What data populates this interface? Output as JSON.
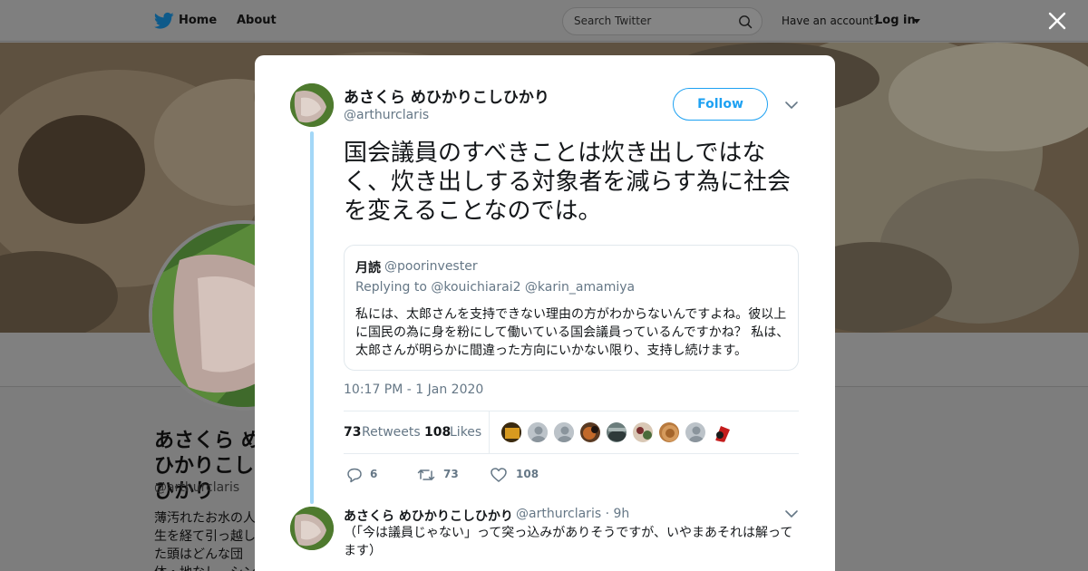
{
  "nav": {
    "home_label": "Home",
    "about_label": "About",
    "search_placeholder": "Search Twitter",
    "have_account": "Have an account?",
    "login_label": "Log in"
  },
  "profile": {
    "name": "あさくら めひかりこしひかり",
    "handle": "@arthurclaris",
    "bio": "薄汚れたお水の人生を経て引っ越した頭はどんな団体・地なし。シン死を主"
  },
  "tweet": {
    "author_name": "あさくら めひかりこしひかり",
    "author_handle": "@arthurclaris",
    "follow_label": "Follow",
    "text": "国会議員のすべきことは炊き出しではなく、炊き出しする対象者を減らす為に社会を変えることなのでは。",
    "quote": {
      "author_name": "月読",
      "author_handle": "@poorinvester",
      "replying_to": "Replying to @kouichiarai2 @karin_amamiya",
      "text": "私には、太郎さんを支持できない理由の方がわからないんですよね。彼以上に国民の為に身を粉にして働いている国会議員っているんですかね？ 私は、太郎さんが明らかに間違った方向にいかない限り、支持し続けます。"
    },
    "timestamp": "10:17 PM - 1 Jan 2020",
    "retweets_count": "73",
    "retweets_label": "Retweets",
    "likes_count": "108",
    "likes_label": "Likes",
    "actions": {
      "reply_count": "6",
      "retweet_count": "73",
      "like_count": "108"
    }
  },
  "reply": {
    "author_name": "あさくら めひかりこしひかり",
    "meta": "@arthurclaris · 9h",
    "text": "（「今は議員じゃない」って突っ込みがありそうですが、いやまあそれは解ってます）"
  },
  "colors": {
    "accent": "#1da1f2",
    "thread_line": "#a3d7f7",
    "secondary_text": "#657786"
  }
}
